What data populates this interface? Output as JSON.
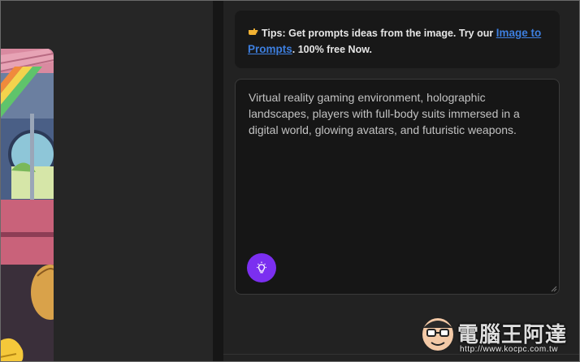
{
  "tips": {
    "icon": "pointing-hand-icon",
    "text_before": "Tips: Get prompts ideas from the image. Try our ",
    "link_label": "Image to Prompts",
    "text_after": ". 100% free Now."
  },
  "prompt": {
    "value": "Virtual reality gaming environment, holographic landscapes, players with full-body suits immersed in a digital world, glowing avatars, and futuristic weapons.",
    "idea_button_icon": "lightbulb-icon"
  },
  "watermark": {
    "brand": "電腦王阿達",
    "url": "http://www.kocpc.com.tw"
  },
  "colors": {
    "accent": "#7b2ff0",
    "link": "#3d7fe0"
  }
}
